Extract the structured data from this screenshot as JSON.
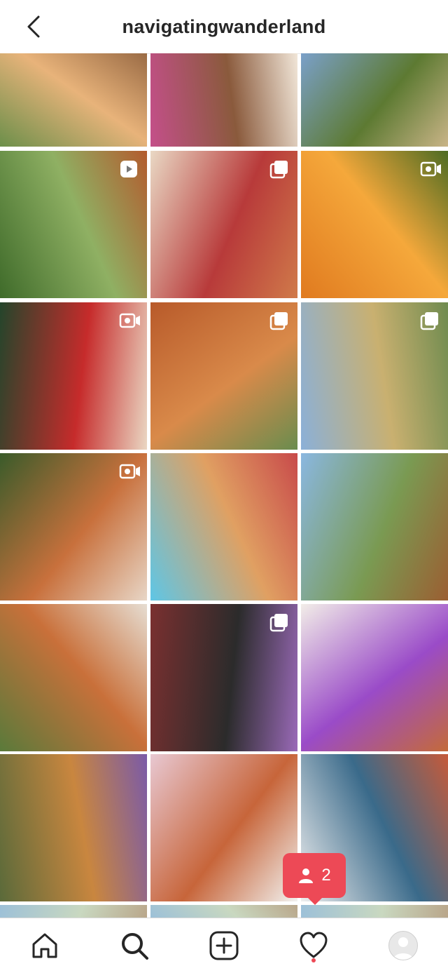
{
  "header": {
    "username": "navigatingwanderland"
  },
  "grid": {
    "tiles": [
      {
        "colors": [
          "#6c8f4a",
          "#e8b37a",
          "#9a6b45"
        ],
        "badge": ""
      },
      {
        "colors": [
          "#c44f8a",
          "#8a5a3c",
          "#f1e6d8"
        ],
        "badge": ""
      },
      {
        "colors": [
          "#7aa0c9",
          "#5d7a32",
          "#c9b487"
        ],
        "badge": ""
      },
      {
        "colors": [
          "#3f6b2a",
          "#8fb063",
          "#b35b2e"
        ],
        "badge": "reel"
      },
      {
        "colors": [
          "#e9d8c4",
          "#b83a3a",
          "#d07a4a"
        ],
        "badge": "multi"
      },
      {
        "colors": [
          "#e07a1f",
          "#f5a83b",
          "#4d6b22"
        ],
        "badge": "video"
      },
      {
        "colors": [
          "#24452b",
          "#c62b2b",
          "#ead7c3"
        ],
        "badge": "video"
      },
      {
        "colors": [
          "#b85a2a",
          "#d98a4a",
          "#6a8c4e"
        ],
        "badge": "multi"
      },
      {
        "colors": [
          "#8bb0d8",
          "#c9b070",
          "#6f8b4f"
        ],
        "badge": "multi"
      },
      {
        "colors": [
          "#3a5b2a",
          "#c8703c",
          "#e8d6c6"
        ],
        "badge": "video"
      },
      {
        "colors": [
          "#5ec6e6",
          "#e0a062",
          "#c84a4a"
        ],
        "badge": ""
      },
      {
        "colors": [
          "#8ab7e0",
          "#7a9a52",
          "#9b5e32"
        ],
        "badge": ""
      },
      {
        "colors": [
          "#5a7a3a",
          "#c9703a",
          "#e6ddd2"
        ],
        "badge": ""
      },
      {
        "colors": [
          "#7a3030",
          "#2b2b2b",
          "#9a6ab8"
        ],
        "badge": "multi"
      },
      {
        "colors": [
          "#f2ede8",
          "#9a4bc8",
          "#c46a3a"
        ],
        "badge": ""
      },
      {
        "colors": [
          "#5a6a3a",
          "#c9863f",
          "#7a5aa8"
        ],
        "badge": ""
      },
      {
        "colors": [
          "#e8c8d2",
          "#c7653a",
          "#f2f2f0"
        ],
        "badge": ""
      },
      {
        "colors": [
          "#efefef",
          "#3a6a8a",
          "#c65a3a"
        ],
        "badge": ""
      }
    ]
  },
  "notification": {
    "count": "2"
  },
  "nav": {
    "items": [
      "home",
      "search",
      "new-post",
      "activity",
      "profile"
    ]
  }
}
